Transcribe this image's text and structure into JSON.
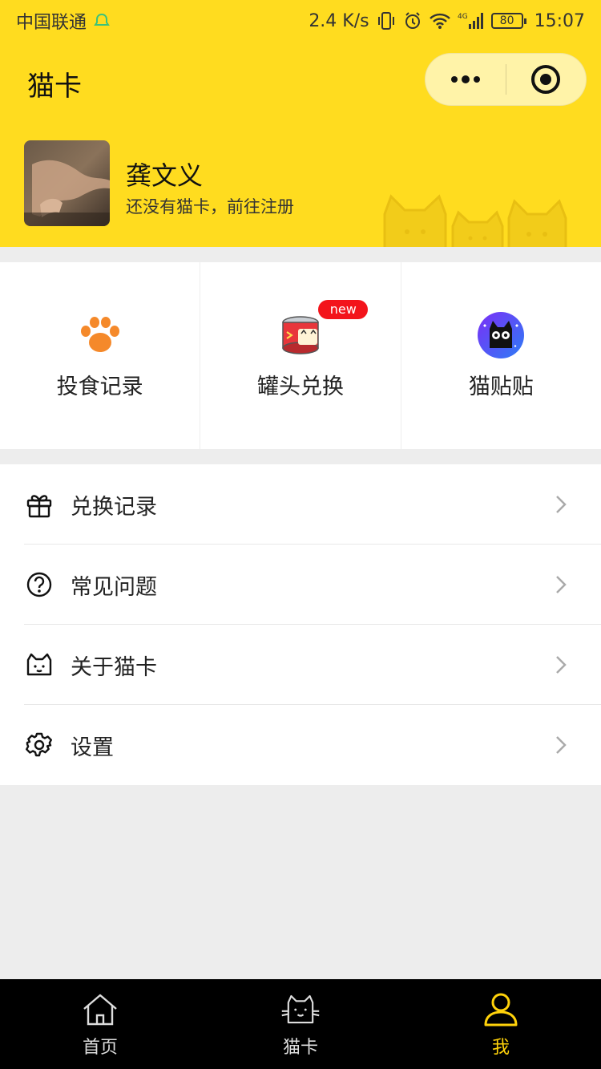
{
  "status_bar": {
    "carrier": "中国联通",
    "net_speed": "2.4 K/s",
    "network": "4G",
    "battery": "80",
    "time": "15:07"
  },
  "header": {
    "title": "猫卡",
    "username": "龚文义",
    "subtitle": "还没有猫卡，前往注册"
  },
  "grid": [
    {
      "label": "投食记录",
      "icon": "paw-icon"
    },
    {
      "label": "罐头兑换",
      "icon": "can-icon",
      "badge": "new"
    },
    {
      "label": "猫贴贴",
      "icon": "cat-sticker-icon"
    }
  ],
  "menu": [
    {
      "label": "兑换记录",
      "icon": "gift-icon"
    },
    {
      "label": "常见问题",
      "icon": "question-icon"
    },
    {
      "label": "关于猫卡",
      "icon": "cat-face-icon"
    },
    {
      "label": "设置",
      "icon": "gear-icon"
    }
  ],
  "tabs": [
    {
      "label": "首页",
      "icon": "home-icon"
    },
    {
      "label": "猫卡",
      "icon": "cat-tab-icon"
    },
    {
      "label": "我",
      "icon": "person-icon",
      "active": true
    }
  ],
  "colors": {
    "brand_yellow": "#ffdc1f",
    "badge_red": "#f3141b",
    "tab_active": "#ffd20a"
  }
}
